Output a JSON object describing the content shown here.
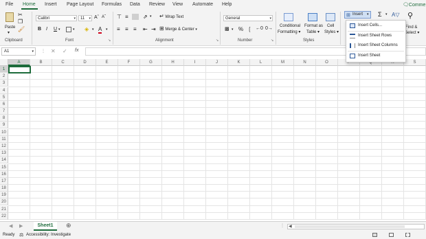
{
  "tabs": [
    "File",
    "Home",
    "Insert",
    "Page Layout",
    "Formulas",
    "Data",
    "Review",
    "View",
    "Automate",
    "Help"
  ],
  "comments_label": "Comme",
  "clipboard": {
    "paste": "Paste",
    "group": "Clipboard"
  },
  "font": {
    "name": "Calibri",
    "size": "11",
    "group": "Font"
  },
  "alignment": {
    "wrap": "Wrap Text",
    "merge": "Merge & Center",
    "group": "Alignment"
  },
  "number": {
    "format": "General",
    "group": "Number"
  },
  "styles": {
    "conditional": "Conditional",
    "conditional2": "Formatting",
    "format_as": "Format as",
    "format_as2": "Table",
    "cell": "Cell",
    "cell2": "Styles",
    "group": "Styles"
  },
  "cells": {
    "insert": "Insert"
  },
  "editing": {
    "find": "Find &",
    "find2": "Select"
  },
  "insert_menu": [
    {
      "label": "Insert Cells..."
    },
    {
      "label": "Insert Sheet Rows"
    },
    {
      "label": "Insert Sheet Columns"
    },
    {
      "label": "Insert Sheet"
    }
  ],
  "namebox": "A1",
  "fx": "fx",
  "columns": [
    "A",
    "B",
    "C",
    "D",
    "E",
    "F",
    "G",
    "H",
    "I",
    "J",
    "K",
    "L",
    "M",
    "N",
    "O",
    "P",
    "Q",
    "R",
    "S"
  ],
  "rows": [
    "1",
    "2",
    "3",
    "4",
    "5",
    "6",
    "7",
    "8",
    "9",
    "10",
    "11",
    "12",
    "13",
    "14",
    "15",
    "16",
    "17",
    "18",
    "19",
    "20",
    "21",
    "22"
  ],
  "sheet_tab": "Sheet1",
  "status": {
    "ready": "Ready",
    "accessibility": "Accessibility: Investigate"
  },
  "accent": "#1d6b3b"
}
